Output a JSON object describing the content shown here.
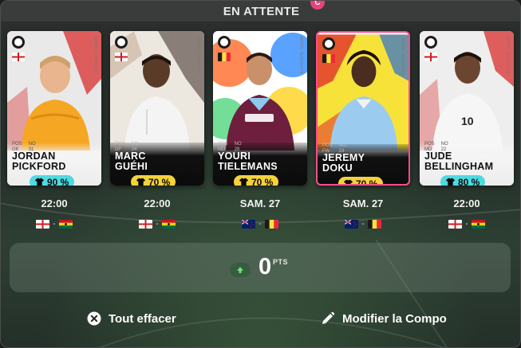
{
  "header": {
    "title": "EN ATTENTE"
  },
  "cards": [
    {
      "first": "JORDAN",
      "last": "PICKFORD",
      "pos": "GK",
      "num": "31",
      "brand": "EUROPE SIGN",
      "percent": "90 %",
      "pill": "cyan",
      "time": "22:00",
      "home": "england",
      "away": "ghana",
      "captain": false
    },
    {
      "first": "MARC",
      "last": "GUÉHI",
      "pos": "DF",
      "num": "24",
      "brand": "EUROPE SIGN",
      "percent": "70 %",
      "pill": "yellow",
      "time": "22:00",
      "home": "england",
      "away": "ghana",
      "captain": false
    },
    {
      "first": "YOURI",
      "last": "TIELEMANS",
      "pos": "MD",
      "num": "28",
      "brand": "EUROPE SIGN",
      "percent": "70 %",
      "pill": "yellow",
      "time": "SAM. 27",
      "home": "new-zealand",
      "away": "belgium",
      "captain": false
    },
    {
      "first": "JEREMY",
      "last": "DOKU",
      "pos": "FW",
      "num": "23",
      "brand": "EUROPE SIGN",
      "percent": "70 %",
      "pill": "yellow",
      "time": "SAM. 27",
      "home": "new-zealand",
      "away": "belgium",
      "captain": true
    },
    {
      "first": "JUDE",
      "last": "BELLINGHAM",
      "pos": "MD",
      "num": "22",
      "brand": "EUROPE SIGN",
      "percent": "80 %",
      "pill": "cyan",
      "time": "22:00",
      "home": "england",
      "away": "ghana",
      "captain": false
    }
  ],
  "captain_badge": "C",
  "score": {
    "value": "0",
    "unit": "PTS",
    "trend_icon": "arrow-up-icon"
  },
  "actions": {
    "clear_label": "Tout effacer",
    "clear_icon": "close-circle-icon",
    "edit_label": "Modifier la Compo",
    "edit_icon": "pencil-icon"
  },
  "colors": {
    "highlight": "#ff4c8a",
    "pill_cyan": "#4fd9e0",
    "pill_yellow": "#f4d23a",
    "captain": "#e8417d"
  }
}
